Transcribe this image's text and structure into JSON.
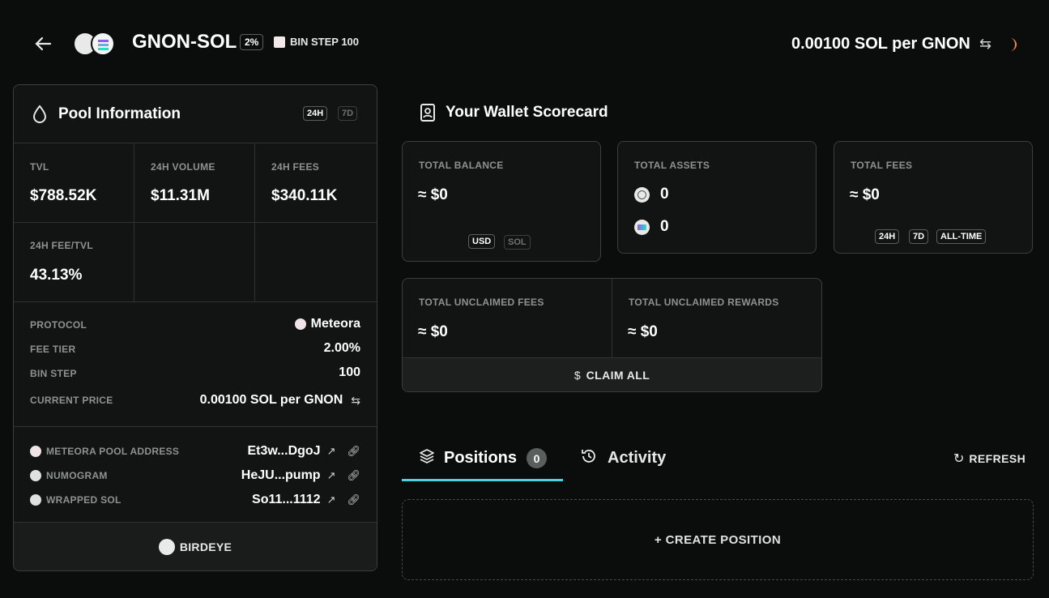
{
  "header": {
    "pair": "GNON-SOL",
    "fee_badge": "2%",
    "bin_step_label": "BIN STEP 100",
    "price": "0.00100 SOL per GNON"
  },
  "pool": {
    "title": "Pool Information",
    "range_active": "24H",
    "range_other": "7D",
    "stats": [
      {
        "label": "TVL",
        "value": "$788.52K"
      },
      {
        "label": "24H VOLUME",
        "value": "$11.31M"
      },
      {
        "label": "24H FEES",
        "value": "$340.11K"
      },
      {
        "label": "24H FEE/TVL",
        "value": "43.13%"
      }
    ],
    "details": [
      {
        "label": "PROTOCOL",
        "value": "Meteora"
      },
      {
        "label": "FEE TIER",
        "value": "2.00%"
      },
      {
        "label": "BIN STEP",
        "value": "100"
      },
      {
        "label": "CURRENT PRICE",
        "value": "0.00100 SOL per GNON"
      }
    ],
    "addresses": [
      {
        "label": "METEORA POOL ADDRESS",
        "value": "Et3w...DgoJ"
      },
      {
        "label": "NUMOGRAM",
        "value": "HeJU...pump"
      },
      {
        "label": "WRAPPED SOL",
        "value": "So11...1112"
      }
    ],
    "footer_link": "BIRDEYE"
  },
  "scorecard": {
    "title": "Your Wallet Scorecard",
    "total_balance": {
      "label": "TOTAL BALANCE",
      "value": "≈ $0",
      "toggle_on": "USD",
      "toggle_off": "SOL"
    },
    "total_assets": {
      "label": "TOTAL ASSETS",
      "gnon": "0",
      "sol": "0"
    },
    "total_fees": {
      "label": "TOTAL FEES",
      "value": "≈ $0",
      "r1": "24H",
      "r2": "7D",
      "r3": "ALL-TIME"
    },
    "unclaimed_fees": {
      "label": "TOTAL UNCLAIMED FEES",
      "value": "≈ $0"
    },
    "unclaimed_rewards": {
      "label": "TOTAL UNCLAIMED REWARDS",
      "value": "≈ $0"
    },
    "claim_all": "CLAIM ALL"
  },
  "tabs": {
    "positions": "Positions",
    "positions_count": "0",
    "activity": "Activity",
    "refresh": "REFRESH"
  },
  "create_position": "+ CREATE POSITION",
  "colors": {
    "accent": "#4fd1e0",
    "spinner": "#f08a3a"
  }
}
